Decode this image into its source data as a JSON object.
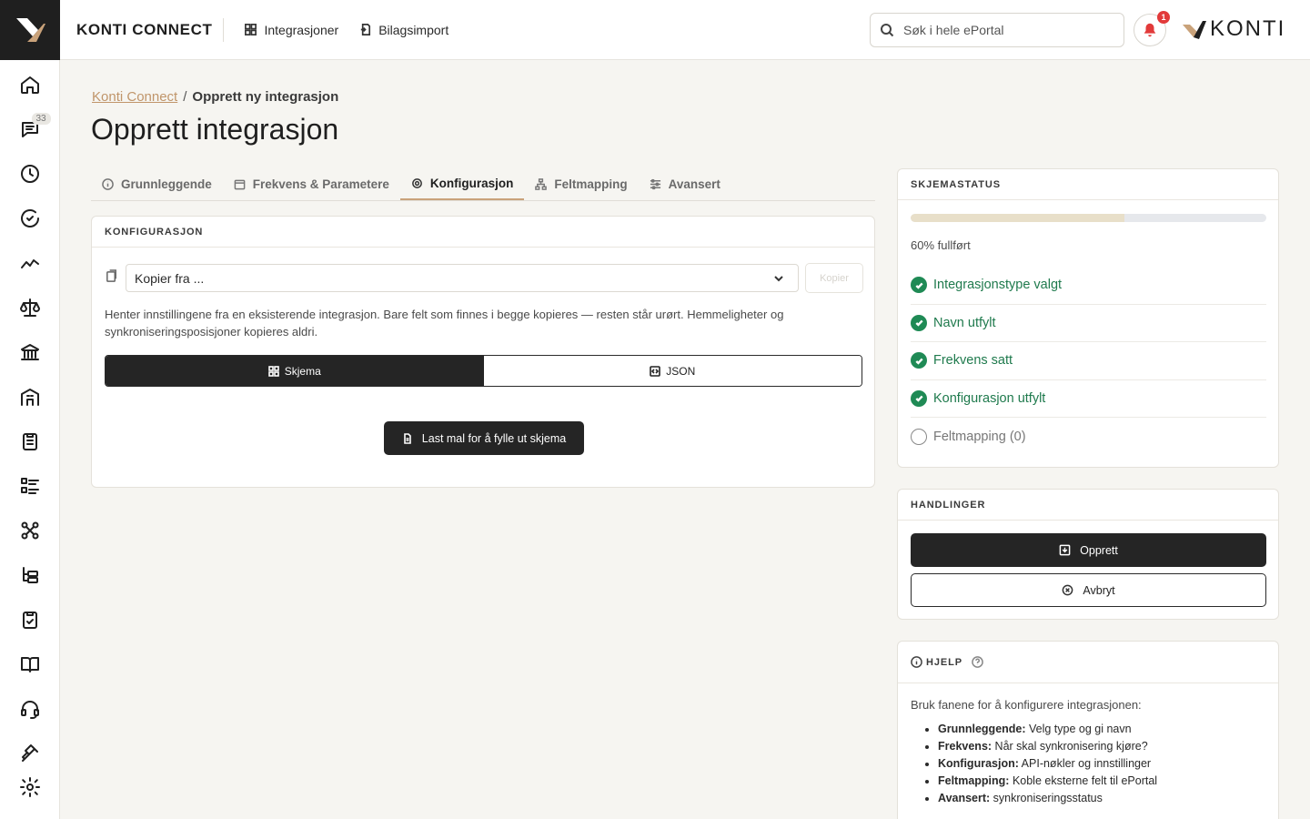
{
  "app": {
    "brand": "KONTI CONNECT",
    "logo_text": "KONTI",
    "nav_badge": "33"
  },
  "topbar": {
    "links": [
      "Integrasjoner",
      "Bilagsimport"
    ],
    "search_placeholder": "Søk i hele ePortal",
    "notification_count": "1"
  },
  "breadcrumb": {
    "parent": "Konti Connect",
    "separator": "/",
    "current": "Opprett ny integrasjon"
  },
  "page": {
    "title": "Opprett integrasjon"
  },
  "tabs": [
    {
      "label": "Grunnleggende",
      "icon": "info-icon"
    },
    {
      "label": "Frekvens & Parametere",
      "icon": "calendar-icon"
    },
    {
      "label": "Konfigurasjon",
      "icon": "gear-icon",
      "active": true
    },
    {
      "label": "Feltmapping",
      "icon": "sitemap-icon"
    },
    {
      "label": "Avansert",
      "icon": "sliders-icon"
    }
  ],
  "config": {
    "heading": "KONFIGURASJON",
    "copy_select_value": "Kopier fra ...",
    "copy_button": "Kopier",
    "help_text": "Henter innstillingene fra en eksisterende integrasjon. Bare felt som finnes i begge kopieres — resten står urørt. Hemmeligheter og synkroniseringsposisjoner kopieres aldri.",
    "mode_schema": "Skjema",
    "mode_json": "JSON",
    "load_template_button": "Last mal for å fylle ut skjema"
  },
  "status": {
    "heading": "SKJEMASTATUS",
    "progress_percent": 60,
    "progress_label": "60% fullført",
    "accent_color": "#1f8a55",
    "items": [
      {
        "label": "Integrasjonstype valgt",
        "done": true
      },
      {
        "label": "Navn utfylt",
        "done": true
      },
      {
        "label": "Frekvens satt",
        "done": true
      },
      {
        "label": "Konfigurasjon utfylt",
        "done": true
      },
      {
        "label": "Feltmapping (0)",
        "done": false
      }
    ]
  },
  "actions": {
    "heading": "HANDLINGER",
    "create_button": "Opprett",
    "cancel_button": "Avbryt"
  },
  "help": {
    "heading": "HJELP",
    "intro": "Bruk fanene for å konfigurere integrasjonen:",
    "items": [
      {
        "term": "Grunnleggende:",
        "desc": " Velg type og gi navn"
      },
      {
        "term": "Frekvens:",
        "desc": " Når skal synkronisering kjøre?"
      },
      {
        "term": "Konfigurasjon:",
        "desc": " API-nøkler og innstillinger"
      },
      {
        "term": "Feltmapping:",
        "desc": " Koble eksterne felt til ePortal"
      },
      {
        "term": "Avansert:",
        "desc": " synkroniseringsstatus"
      }
    ]
  }
}
